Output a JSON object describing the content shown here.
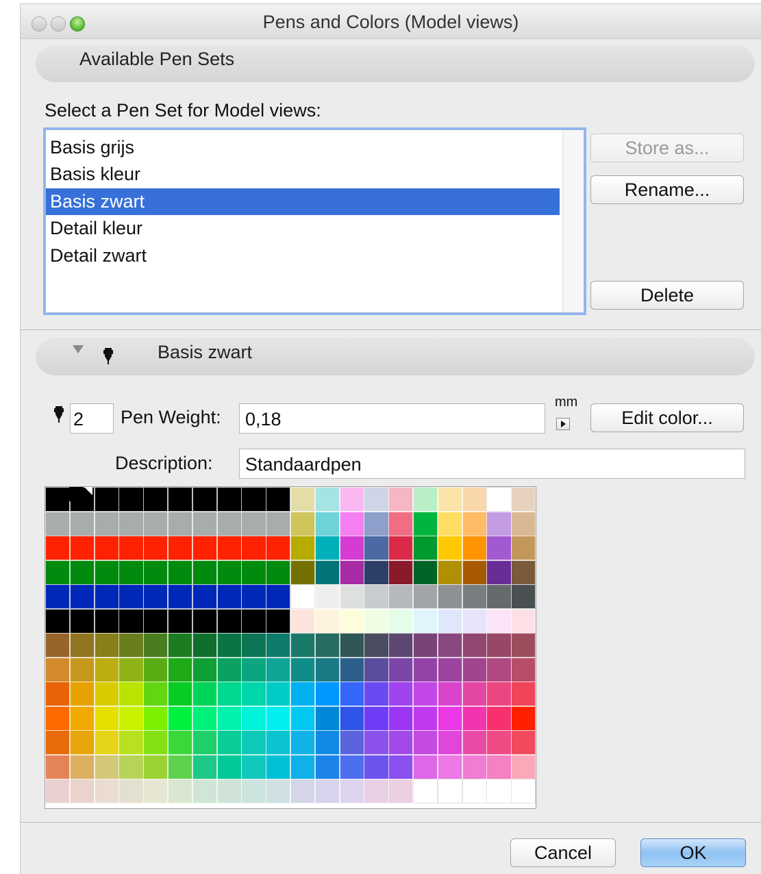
{
  "window": {
    "title": "Pens and Colors (Model views)"
  },
  "pen_sets": {
    "section_title": "Available Pen Sets",
    "select_label": "Select a Pen Set for Model views:",
    "items": [
      {
        "label": "Basis grijs",
        "selected": false
      },
      {
        "label": "Basis kleur",
        "selected": false
      },
      {
        "label": "Basis zwart",
        "selected": true
      },
      {
        "label": "Detail kleur",
        "selected": false
      },
      {
        "label": "Detail zwart",
        "selected": false
      }
    ],
    "store_as_label": "Store as...",
    "rename_label": "Rename...",
    "delete_label": "Delete"
  },
  "pen_detail": {
    "section_title": "Basis zwart",
    "pen_number": "2",
    "pen_weight_label": "Pen Weight:",
    "pen_weight_value": "0,18",
    "unit_label": "mm",
    "edit_color_label": "Edit color...",
    "description_label": "Description:",
    "description_value": "Standaardpen"
  },
  "color_grid": {
    "columns": 20,
    "rows": [
      [
        "#000000",
        "#000000",
        "#000000",
        "#000000",
        "#000000",
        "#000000",
        "#000000",
        "#000000",
        "#000000",
        "#000000",
        "#e3dea6",
        "#a6e3e3",
        "#f9b8f2",
        "#cfd5e6",
        "#f7b6c4",
        "#b9efc6",
        "#fbe4a7",
        "#f9d7ac",
        "#ffffff",
        "#e6d2bf"
      ],
      [
        "#a8acad",
        "#a8acad",
        "#a8acad",
        "#a8acad",
        "#a8acad",
        "#a8acad",
        "#a8acad",
        "#a8acad",
        "#a8acad",
        "#a8acad",
        "#cfc55a",
        "#6dd3d7",
        "#f57ef2",
        "#8e9fcc",
        "#f06e85",
        "#00b53f",
        "#ffdd62",
        "#ffbb66",
        "#c49ce2",
        "#d9b994"
      ],
      [
        "#ff2200",
        "#ff2200",
        "#ff2200",
        "#ff2200",
        "#ff2200",
        "#ff2200",
        "#ff2200",
        "#ff2200",
        "#ff2200",
        "#ff2200",
        "#b6ac00",
        "#00b1bb",
        "#d63bd2",
        "#4d69a3",
        "#db2a48",
        "#009a2e",
        "#ffc800",
        "#ff9400",
        "#a25ad1",
        "#c3975a"
      ],
      [
        "#008a0e",
        "#008a0e",
        "#008a0e",
        "#008a0e",
        "#008a0e",
        "#008a0e",
        "#008a0e",
        "#008a0e",
        "#008a0e",
        "#008a0e",
        "#747100",
        "#007479",
        "#a72ba5",
        "#2d3f69",
        "#891a2b",
        "#006328",
        "#b09000",
        "#a85a00",
        "#6a2d95",
        "#7a5a3a"
      ],
      [
        "#0028b8",
        "#0028b8",
        "#0028b8",
        "#0028b8",
        "#0028b8",
        "#0028b8",
        "#0028b8",
        "#0028b8",
        "#0028b8",
        "#0028b8",
        "#ffffff",
        "#eeeeee",
        "#dee0e0",
        "#c9ccce",
        "#b5b9bb",
        "#a1a5a8",
        "#8d9194",
        "#797e81",
        "#656a6d",
        "#4a4f52"
      ],
      [
        "#000000",
        "#000000",
        "#000000",
        "#000000",
        "#000000",
        "#000000",
        "#000000",
        "#000000",
        "#000000",
        "#000000",
        "#fee3dc",
        "#fef3dc",
        "#fdfddc",
        "#eefde3",
        "#e3fde9",
        "#dff5fb",
        "#dfe7fb",
        "#e7e3fb",
        "#fbe3f8",
        "#fde0e6"
      ],
      [
        "#97642a",
        "#917520",
        "#87801b",
        "#6a7e1d",
        "#4a7d1e",
        "#1d7b22",
        "#0f6f2d",
        "#0b7444",
        "#0b7556",
        "#0d7b69",
        "#1a7a6a",
        "#266c60",
        "#315656",
        "#4a4c60",
        "#5c4870",
        "#7a4378",
        "#8a4880",
        "#904872",
        "#984866",
        "#9c4d5c"
      ],
      [
        "#d38a2c",
        "#c6981c",
        "#bbad12",
        "#8fb216",
        "#5aac13",
        "#1faa17",
        "#0f9f35",
        "#0aa262",
        "#0aa680",
        "#0ea597",
        "#108d87",
        "#1c7a86",
        "#2c5f8a",
        "#5a4da0",
        "#7c45a8",
        "#9444a8",
        "#9c44a0",
        "#a2448e",
        "#b04a80",
        "#b84d68"
      ],
      [
        "#e86208",
        "#e6a200",
        "#d8cc00",
        "#b9e400",
        "#62d610",
        "#08cc24",
        "#00d35a",
        "#00d88e",
        "#00d6ac",
        "#00ccc6",
        "#00b0f0",
        "#0098ff",
        "#3466f8",
        "#6b4af4",
        "#a044f0",
        "#c248e8",
        "#da44cc",
        "#e446a4",
        "#ec4680",
        "#f04458"
      ],
      [
        "#ff6a00",
        "#f2a900",
        "#e6e000",
        "#c8f200",
        "#7cf000",
        "#00f040",
        "#00f07c",
        "#00f2ac",
        "#00f2d8",
        "#00f0f2",
        "#00c8f0",
        "#0088d8",
        "#2e55e8",
        "#6f3cf8",
        "#9a36f4",
        "#c23af0",
        "#ea38e4",
        "#f234b0",
        "#f8306e",
        "#ff2000"
      ],
      [
        "#e86a08",
        "#e8a50a",
        "#e6d41a",
        "#b8e220",
        "#84e012",
        "#3ad83a",
        "#1fd06a",
        "#0acc96",
        "#0ccab8",
        "#0ac4d2",
        "#10b2e8",
        "#108ae4",
        "#5a62dc",
        "#8a52ea",
        "#a24ae8",
        "#c44ae4",
        "#e046d8",
        "#e84aa6",
        "#f04a84",
        "#f04a5c"
      ],
      [
        "#e48456",
        "#dcb060",
        "#d2c878",
        "#b8d458",
        "#9cd234",
        "#5ed24e",
        "#1ec888",
        "#00c896",
        "#10c8be",
        "#00c0d6",
        "#10b0e8",
        "#1c84e8",
        "#4e6ef0",
        "#6c54ee",
        "#8a50f0",
        "#dc68e8",
        "#ee78e6",
        "#f07cd4",
        "#f680c0",
        "#fca8b8"
      ],
      [
        "#ebd0d2",
        "#ead3cd",
        "#eadcd0",
        "#e3e0cf",
        "#e6e6d2",
        "#d9e6d0",
        "#cfe5d5",
        "#cfe3d8",
        "#cde3de",
        "#cfe1e3",
        "#d4d5e6",
        "#d6d4ec",
        "#dcd4ec",
        "#e8cfe6",
        "#ecd0e2",
        "#ffffff",
        "#ffffff",
        "#ffffff",
        "#ffffff",
        "#ffffff"
      ]
    ]
  },
  "footer": {
    "cancel_label": "Cancel",
    "ok_label": "OK"
  }
}
